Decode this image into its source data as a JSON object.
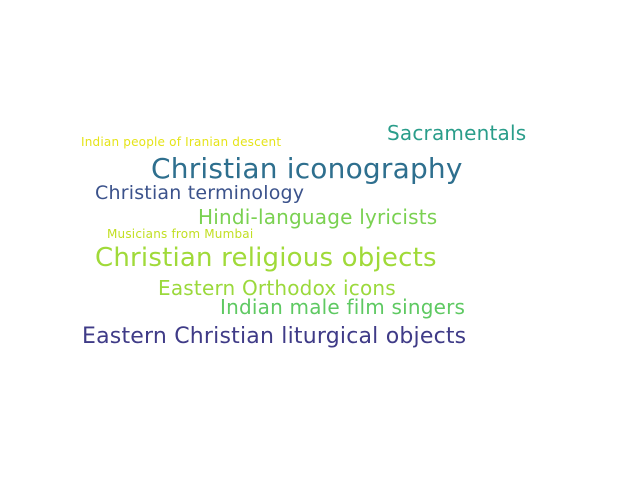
{
  "word_cloud": {
    "background": "#ffffff",
    "words": [
      {
        "text": "Christian religious objects",
        "color": "#a0da39"
      },
      {
        "text": "Christian iconography",
        "color": "#2e6f8e"
      },
      {
        "text": "Eastern Christian liturgical objects",
        "color": "#3f3b87"
      },
      {
        "text": "Hindi-language lyricists",
        "color": "#7ad151"
      },
      {
        "text": "Indian male film singers",
        "color": "#5ec962"
      },
      {
        "text": "Christian terminology",
        "color": "#3b528b"
      },
      {
        "text": "Eastern Orthodox icons",
        "color": "#9bd93c"
      },
      {
        "text": "Sacramentals",
        "color": "#2a9d8a"
      },
      {
        "text": "Indian people of Iranian descent",
        "color": "#e5e419"
      },
      {
        "text": "Musicians from Mumbai",
        "color": "#c2df23"
      }
    ]
  }
}
